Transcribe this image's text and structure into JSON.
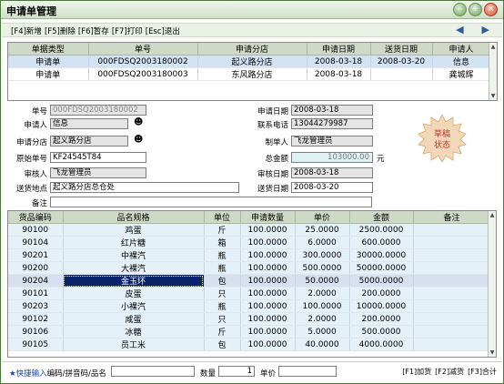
{
  "window": {
    "title": "申请单管理",
    "controls": [
      "minimize-icon",
      "maximize-icon",
      "close-icon"
    ]
  },
  "toolbar": {
    "keys": [
      "[F4]新增",
      "[F5]删除",
      "[F6]暂存",
      "[F7]打印",
      "[Esc]退出"
    ],
    "nav": [
      "previous-icon",
      "next-icon"
    ]
  },
  "doc_list": {
    "columns": [
      "单据类型",
      "单号",
      "申请分店",
      "申请日期",
      "送货日期",
      "申请人"
    ],
    "rows": [
      [
        "申请单",
        "000FDSQ2003180002",
        "起义路分店",
        "2008-03-18",
        "2008-03-20",
        "信息"
      ],
      [
        "申请单",
        "000FDSQ2003180003",
        "东风路分店",
        "2008-03-18",
        "",
        "龚城辉"
      ]
    ]
  },
  "form": {
    "doc_no_label": "单号",
    "doc_no": "000FDSQ2003180002",
    "apply_date_label": "申请日期",
    "apply_date": "2008-03-18",
    "applicant_label": "申请人",
    "applicant": "信息",
    "phone_label": "联系电话",
    "phone": "13044279987",
    "branch_label": "申请分店",
    "branch": "起义路分店",
    "maker_label": "制单人",
    "maker": "飞龙管理员",
    "orig_no_label": "原始单号",
    "orig_no": "KF24545T84",
    "total_label": "总金额",
    "total": "103000.00",
    "total_unit": "元",
    "reviewer_label": "审核人",
    "reviewer": "飞龙管理员",
    "review_date_label": "审核日期",
    "review_date": "2008-03-18",
    "ship_addr_label": "送货地点",
    "ship_addr": "起义路分店总仓处",
    "ship_date_label": "送货日期",
    "ship_date": "2008-03-20",
    "remark_label": "备注",
    "remark": "",
    "stamp_line1": "草稿",
    "stamp_line2": "状态"
  },
  "items": {
    "columns": [
      "货品编码",
      "品名规格",
      "单位",
      "申请数量",
      "单价",
      "金额",
      "备注"
    ],
    "rows": [
      [
        "90100",
        "鸡蛋",
        "斤",
        "100.0000",
        "25.0000",
        "2500.0000",
        ""
      ],
      [
        "90104",
        "红片糖",
        "箱",
        "100.0000",
        "6.0000",
        "600.0000",
        ""
      ],
      [
        "90201",
        "中裸汽",
        "瓶",
        "100.0000",
        "300.0000",
        "30000.0000",
        ""
      ],
      [
        "90200",
        "大裸汽",
        "瓶",
        "100.0000",
        "500.0000",
        "50000.0000",
        ""
      ],
      [
        "90204",
        "金玉环",
        "包",
        "100.0000",
        "50.0000",
        "5000.0000",
        ""
      ],
      [
        "90101",
        "皮蛋",
        "只",
        "100.0000",
        "2.0000",
        "200.0000",
        ""
      ],
      [
        "90203",
        "小裸汽",
        "瓶",
        "100.0000",
        "100.0000",
        "10000.0000",
        ""
      ],
      [
        "90102",
        "咸蛋",
        "只",
        "100.0000",
        "2.0000",
        "200.0000",
        ""
      ],
      [
        "90106",
        "冰糖",
        "斤",
        "100.0000",
        "5.0000",
        "500.0000",
        ""
      ],
      [
        "90105",
        "员工米",
        "包",
        "100.0000",
        "40.0000",
        "4000.0000",
        ""
      ]
    ],
    "selected_row": 4
  },
  "bottom": {
    "quick_star": "★",
    "quick_label": "快捷输入",
    "quick_hint": "编码/拼音码/品名",
    "qty_label": "数量",
    "qty_value": "1",
    "price_label": "单价",
    "hotkeys": [
      "[F1]加货",
      "[F2]减货",
      "[F3]合计"
    ]
  }
}
